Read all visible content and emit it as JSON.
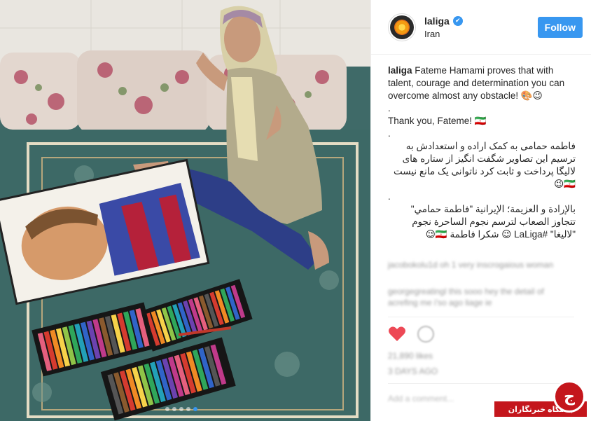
{
  "post": {
    "username": "laliga",
    "location": "Iran",
    "follow_label": "Follow",
    "verified_glyph": "✔"
  },
  "caption": {
    "username": "laliga",
    "line1": " Fateme Hamami proves that with talent, courage and determination you can overcome almost any obstacle! 🎨😉",
    "dot1": ".",
    "line2": "Thank you, Fateme! 🇮🇷",
    "dot2": ".",
    "persian": "فاطمه حمامی به کمک اراده و استعدادش به ترسیم این تصاویر شگفت انگیز از ستاره های لالیگا پرداخت و ثابت کرد ناتوانی یک مانع نیست 🇮🇷😉",
    "dot3": ".",
    "arabic": "بالإرادة و العزيمة؛ الإيرانية \"فاطمة حمامي\" تتجاوز الصعاب لترسم نجوم الساحرة نجوم \"لاليغا\" #LaLiga 😉 شكرا فاطمة 🇮🇷😉"
  },
  "comments_blurred": [
    "jacobokolu1d oh 1 very inscrogaious woman",
    "georgegreatingl this sooo hey the detail of acrefing me i'so ago liage ie"
  ],
  "likes_blurred": "21,890 likes",
  "time_blurred": "3 DAYS AGO",
  "add_comment_blurred": "Add a comment...",
  "watermark": {
    "text": "باشگاه خبرنگاران",
    "logo_glyph": "ج"
  },
  "colors": {
    "accent": "#3897f0",
    "text": "#262626",
    "watermark_red": "#c4161c",
    "heart_red": "#ed4956"
  },
  "carousel": {
    "count": 5,
    "active_index": 4
  }
}
